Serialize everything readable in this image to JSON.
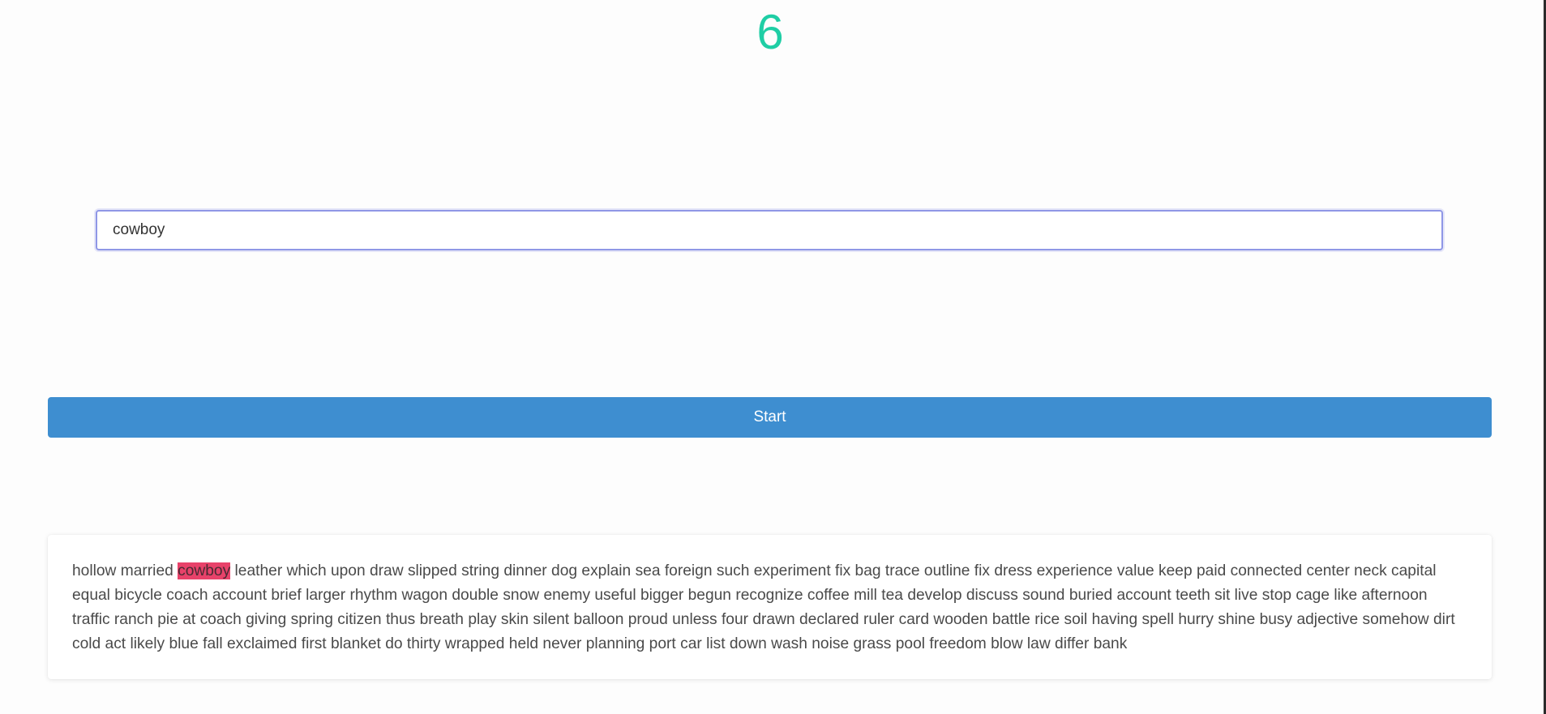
{
  "timer": {
    "value": "6"
  },
  "input": {
    "value": "cowboy",
    "placeholder": ""
  },
  "start_button": {
    "label": "Start"
  },
  "words": {
    "current_index": 2,
    "list": [
      "hollow",
      "married",
      "cowboy",
      "leather",
      "which",
      "upon",
      "draw",
      "slipped",
      "string",
      "dinner",
      "dog",
      "explain",
      "sea",
      "foreign",
      "such",
      "experiment",
      "fix",
      "bag",
      "trace",
      "outline",
      "fix",
      "dress",
      "experience",
      "value",
      "keep",
      "paid",
      "connected",
      "center",
      "neck",
      "capital",
      "equal",
      "bicycle",
      "coach",
      "account",
      "brief",
      "larger",
      "rhythm",
      "wagon",
      "double",
      "snow",
      "enemy",
      "useful",
      "bigger",
      "begun",
      "recognize",
      "coffee",
      "mill",
      "tea",
      "develop",
      "discuss",
      "sound",
      "buried",
      "account",
      "teeth",
      "sit",
      "live",
      "stop",
      "cage",
      "like",
      "afternoon",
      "traffic",
      "ranch",
      "pie",
      "at",
      "coach",
      "giving",
      "spring",
      "citizen",
      "thus",
      "breath",
      "play",
      "skin",
      "silent",
      "balloon",
      "proud",
      "unless",
      "four",
      "drawn",
      "declared",
      "ruler",
      "card",
      "wooden",
      "battle",
      "rice",
      "soil",
      "having",
      "spell",
      "hurry",
      "shine",
      "busy",
      "adjective",
      "somehow",
      "dirt",
      "cold",
      "act",
      "likely",
      "blue",
      "fall",
      "exclaimed",
      "first",
      "blanket",
      "do",
      "thirty",
      "wrapped",
      "held",
      "never",
      "planning",
      "port",
      "car",
      "list",
      "down",
      "wash",
      "noise",
      "grass",
      "pool",
      "freedom",
      "blow",
      "law",
      "differ",
      "bank"
    ]
  },
  "colors": {
    "timer": "#1fcea5",
    "start_button": "#3e8ed0",
    "current_word_highlight": "#e8426a",
    "input_focus_border": "#8f97e6"
  }
}
